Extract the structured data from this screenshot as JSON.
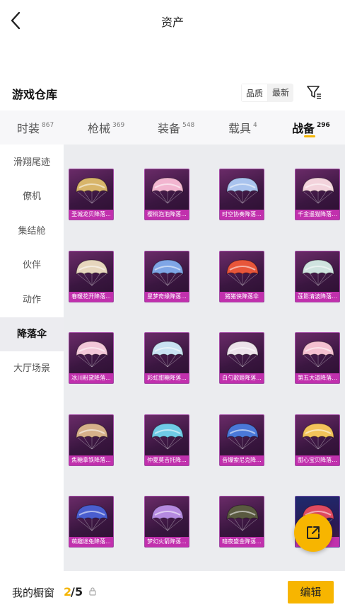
{
  "header": {
    "title": "资产"
  },
  "warehouse": {
    "title": "游戏仓库",
    "sort_options": [
      {
        "label": "品质",
        "active": true
      },
      {
        "label": "最新",
        "active": false
      }
    ]
  },
  "tabs": [
    {
      "label": "时装",
      "count": "867"
    },
    {
      "label": "枪械",
      "count": "369"
    },
    {
      "label": "装备",
      "count": "548"
    },
    {
      "label": "载具",
      "count": "4"
    },
    {
      "label": "战备",
      "count": "296",
      "active": true
    }
  ],
  "sidebar": {
    "items": [
      {
        "label": "滑翔尾迹"
      },
      {
        "label": "僚机"
      },
      {
        "label": "集结舱"
      },
      {
        "label": "伙伴"
      },
      {
        "label": "动作"
      },
      {
        "label": "降落伞",
        "active": true
      },
      {
        "label": "大厅场景"
      }
    ]
  },
  "items": [
    {
      "label": "圣城龙贝降落...",
      "color": "#d8b56a"
    },
    {
      "label": "樱桃泡泡降落...",
      "color": "#f2b5d0"
    },
    {
      "label": "时空协奏降落...",
      "color": "#a9c3ee"
    },
    {
      "label": "千金遥猫降落...",
      "color": "#f3d3dc"
    },
    {
      "label": "春暖花开降落...",
      "color": "#e6d6bd"
    },
    {
      "label": "星梦奇缘降落...",
      "color": "#7fa6e6"
    },
    {
      "label": "猪猪侠降落伞",
      "color": "#e8563a"
    },
    {
      "label": "莲影清波降落...",
      "color": "#cfe3df"
    },
    {
      "label": "冰川粉黛降落...",
      "color": "#f2c7d8"
    },
    {
      "label": "彩虹甜糖降落...",
      "color": "#c9e2f2"
    },
    {
      "label": "白勺歌姬降落...",
      "color": "#ece2ea"
    },
    {
      "label": "第五大道降落...",
      "color": "#f4c0d0"
    },
    {
      "label": "焦糖拿铁降落...",
      "color": "#d6b08a"
    },
    {
      "label": "仲夏莫吉托降...",
      "color": "#6fcbe6"
    },
    {
      "label": "音爆索尼克降...",
      "color": "#4a78d8"
    },
    {
      "label": "甜心宝贝降落...",
      "color": "#f2c35a"
    },
    {
      "label": "萌趣迷兔降落...",
      "color": "#4a5ecf"
    },
    {
      "label": "梦幻火箭降落...",
      "color": "#b58ae0"
    },
    {
      "label": "暗夜盛金降落...",
      "color": "#5a5a40"
    },
    {
      "label": "",
      "color": "#e04a60"
    }
  ],
  "bottom": {
    "label": "我的橱窗",
    "current": "2",
    "separator": "/",
    "max": "5",
    "edit_label": "编辑"
  },
  "icons": {
    "back": "chevron-left-icon",
    "filter": "filter-icon",
    "share": "external-link-icon",
    "lock": "lock-icon"
  },
  "colors": {
    "accent": "#f7b500",
    "card_label": "#c130ad"
  }
}
